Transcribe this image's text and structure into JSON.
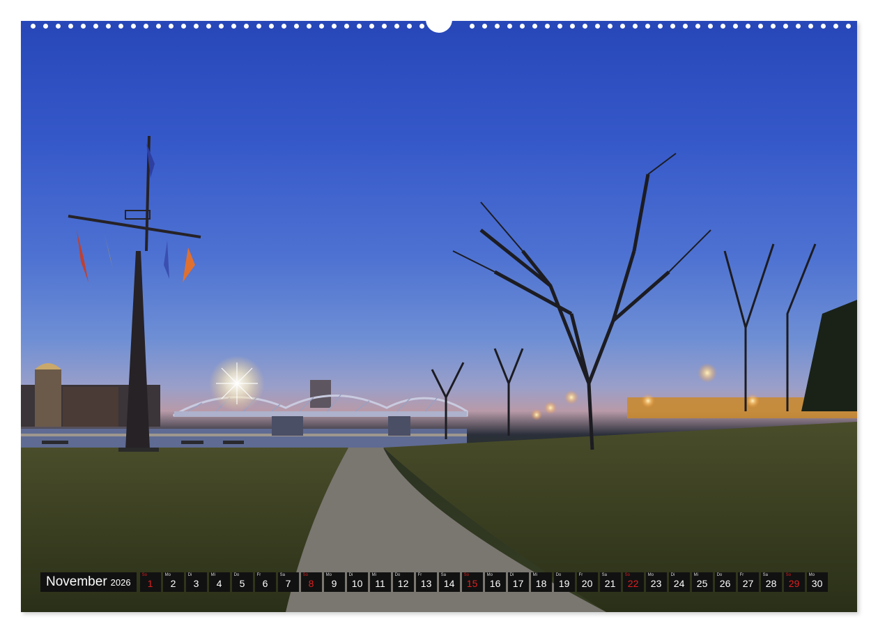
{
  "calendar": {
    "month": "November",
    "year": "2026",
    "days": [
      {
        "num": "1",
        "wd": "So",
        "sunday": true
      },
      {
        "num": "2",
        "wd": "Mo",
        "sunday": false
      },
      {
        "num": "3",
        "wd": "Di",
        "sunday": false
      },
      {
        "num": "4",
        "wd": "Mi",
        "sunday": false
      },
      {
        "num": "5",
        "wd": "Do",
        "sunday": false
      },
      {
        "num": "6",
        "wd": "Fr",
        "sunday": false
      },
      {
        "num": "7",
        "wd": "Sa",
        "sunday": false
      },
      {
        "num": "8",
        "wd": "So",
        "sunday": true
      },
      {
        "num": "9",
        "wd": "Mo",
        "sunday": false
      },
      {
        "num": "10",
        "wd": "Di",
        "sunday": false
      },
      {
        "num": "11",
        "wd": "Mi",
        "sunday": false
      },
      {
        "num": "12",
        "wd": "Do",
        "sunday": false
      },
      {
        "num": "13",
        "wd": "Fr",
        "sunday": false
      },
      {
        "num": "14",
        "wd": "Sa",
        "sunday": false
      },
      {
        "num": "15",
        "wd": "So",
        "sunday": true
      },
      {
        "num": "16",
        "wd": "Mo",
        "sunday": false
      },
      {
        "num": "17",
        "wd": "Di",
        "sunday": false
      },
      {
        "num": "18",
        "wd": "Mi",
        "sunday": false
      },
      {
        "num": "19",
        "wd": "Do",
        "sunday": false
      },
      {
        "num": "20",
        "wd": "Fr",
        "sunday": false
      },
      {
        "num": "21",
        "wd": "Sa",
        "sunday": false
      },
      {
        "num": "22",
        "wd": "So",
        "sunday": true
      },
      {
        "num": "23",
        "wd": "Mo",
        "sunday": false
      },
      {
        "num": "24",
        "wd": "Di",
        "sunday": false
      },
      {
        "num": "25",
        "wd": "Mi",
        "sunday": false
      },
      {
        "num": "26",
        "wd": "Do",
        "sunday": false
      },
      {
        "num": "27",
        "wd": "Fr",
        "sunday": false
      },
      {
        "num": "28",
        "wd": "Sa",
        "sunday": false
      },
      {
        "num": "29",
        "wd": "So",
        "sunday": true
      },
      {
        "num": "30",
        "wd": "Mo",
        "sunday": false
      }
    ]
  },
  "colors": {
    "sky_top": "#2747b8",
    "sky_horizon": "#b89aa8",
    "grass": "#353d22",
    "path": "#7a7670",
    "lights": "#ffb84a",
    "sunday_red": "#e02020",
    "strip_bg": "#111111"
  }
}
